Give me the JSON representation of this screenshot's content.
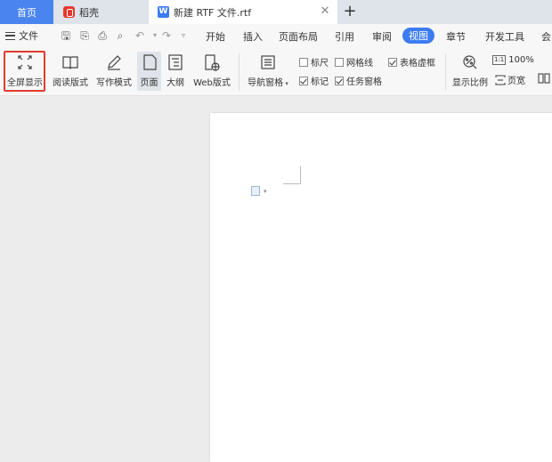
{
  "tabs": {
    "home": "首页",
    "docer": "稻壳",
    "document": "新建 RTF 文件.rtf",
    "new_tab": "+"
  },
  "menu": {
    "file": "文件",
    "items": [
      "开始",
      "插入",
      "页面布局",
      "引用",
      "审阅",
      "视图",
      "章节",
      "开发工具",
      "会"
    ],
    "active": "视图"
  },
  "ribbon": {
    "fullscreen": "全屏显示",
    "reading": "阅读版式",
    "writing": "写作模式",
    "page": "页面",
    "outline": "大纲",
    "web": "Web版式",
    "nav_pane": "导航窗格",
    "ruler": "标尺",
    "grid": "网格线",
    "table_frame": "表格虚框",
    "marks": "标记",
    "task_pane": "任务窗格",
    "zoom_label": "显示比例",
    "zoom_value": "100%",
    "zoom_tag": "1:1",
    "page_width": "页宽",
    "checkboxes": {
      "ruler": false,
      "grid": false,
      "table_frame": true,
      "marks": true,
      "task_pane": true
    }
  },
  "colors": {
    "accent": "#3c7cf2",
    "home_tab": "#4a84ee",
    "highlight_border": "#e03c31"
  }
}
